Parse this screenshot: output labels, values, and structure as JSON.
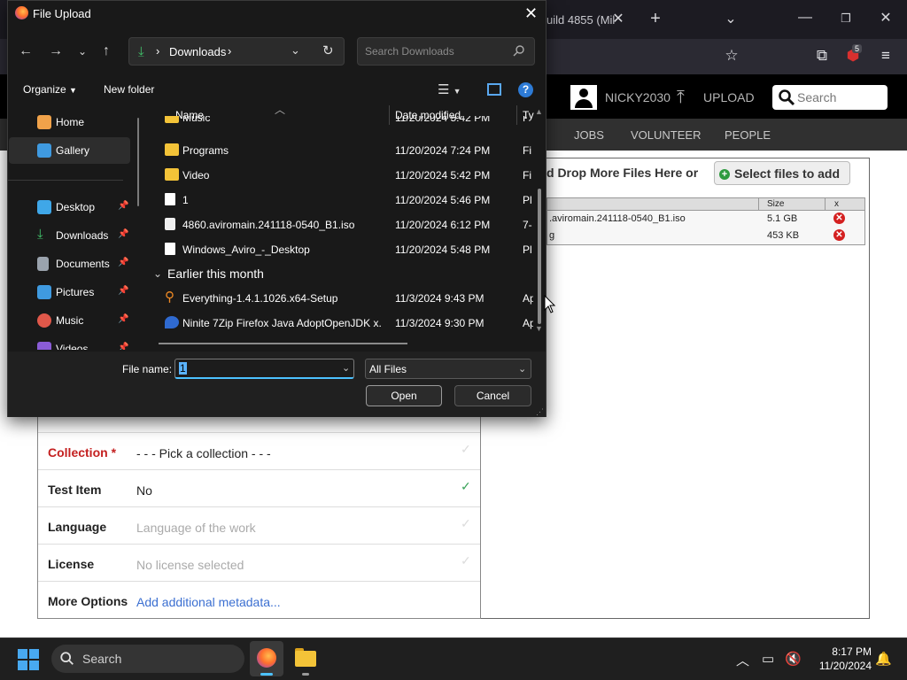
{
  "browser": {
    "tab_title": "uild 4855 (Mil",
    "extension_badge": "5"
  },
  "site": {
    "username": "NICKY2030",
    "upload_label": "UPLOAD",
    "search_label": "Search",
    "nav": [
      "JOBS",
      "VOLUNTEER",
      "PEOPLE"
    ],
    "drop_text": "d Drop More Files Here or",
    "select_files_label": "Select files to add",
    "file_table": {
      "col_size": "Size",
      "col_x": "x",
      "rows": [
        {
          "name": ".aviromain.241118-0540_B1.iso",
          "size": "5.1 GB"
        },
        {
          "name": "g",
          "size": "453 KB"
        }
      ]
    },
    "form": [
      {
        "label": "Collection",
        "required": "*",
        "value": "- - - Pick a collection - - -",
        "value_color": "#222222",
        "check": "✓"
      },
      {
        "label": "Test Item",
        "required": "",
        "value": "No",
        "value_color": "#222222",
        "check": "✓"
      },
      {
        "label": "Language",
        "required": "",
        "value": "Language of the work",
        "value_color": "#aaaaaa",
        "check": "✓"
      },
      {
        "label": "License",
        "required": "",
        "value": "No license selected",
        "value_color": "#aaaaaa",
        "check": "✓"
      },
      {
        "label": "More Options",
        "required": "",
        "value": "Add additional metadata...",
        "value_color": "#3b6fd1",
        "check": ""
      }
    ]
  },
  "dialog": {
    "title": "File Upload",
    "address": "Downloads",
    "search_placeholder": "Search Downloads",
    "organize_label": "Organize",
    "new_folder_label": "New folder",
    "nav_items": [
      {
        "label": "Home",
        "icon": "home-icon",
        "color": "#f0a24a",
        "pinned": ""
      },
      {
        "label": "Gallery",
        "icon": "gallery-icon",
        "color": "#3f9ae0",
        "pinned": ""
      },
      {
        "label": "Desktop",
        "icon": "desktop-icon",
        "color": "#3fa7e8",
        "pinned": "📌"
      },
      {
        "label": "Downloads",
        "icon": "download-icon",
        "color": "#41c26a",
        "pinned": "📌"
      },
      {
        "label": "Documents",
        "icon": "documents-icon",
        "color": "#9aa3ad",
        "pinned": "📌"
      },
      {
        "label": "Pictures",
        "icon": "pictures-icon",
        "color": "#3f9ae0",
        "pinned": "📌"
      },
      {
        "label": "Music",
        "icon": "music-icon",
        "color": "#e0584a",
        "pinned": "📌"
      },
      {
        "label": "Videos",
        "icon": "videos-icon",
        "color": "#8a5cd6",
        "pinned": "📌"
      }
    ],
    "columns": {
      "name": "Name",
      "date": "Date modified",
      "type": "Ty"
    },
    "files": [
      {
        "name": "Music",
        "date": "11/20/2024 5:42 PM",
        "type": "Fi",
        "icon": "folder-icon"
      },
      {
        "name": "Programs",
        "date": "11/20/2024 7:24 PM",
        "type": "Fi",
        "icon": "folder-icon"
      },
      {
        "name": "Video",
        "date": "11/20/2024 5:42 PM",
        "type": "Fi",
        "icon": "folder-icon"
      },
      {
        "name": "1",
        "date": "11/20/2024 5:46 PM",
        "type": "Pl",
        "icon": "doc-icon"
      },
      {
        "name": "4860.aviromain.241118-0540_B1.iso",
        "date": "11/20/2024 6:12 PM",
        "type": "7-",
        "icon": "iso-icon"
      },
      {
        "name": "Windows_Aviro_-_Desktop",
        "date": "11/20/2024 5:48 PM",
        "type": "Pl",
        "icon": "doc-icon"
      }
    ],
    "group_label": "Earlier this month",
    "earlier_files": [
      {
        "name": "Everything-1.4.1.1026.x64-Setup",
        "date": "11/3/2024 9:43 PM",
        "type": "Ap",
        "icon": "setup-icon"
      },
      {
        "name": "Ninite 7Zip Firefox Java AdoptOpenJDK x...",
        "date": "11/3/2024 9:30 PM",
        "type": "Ap",
        "icon": "ninite-icon"
      }
    ],
    "file_name_label": "File name:",
    "file_name_value": "1",
    "file_type_value": "All Files",
    "open_label": "Open",
    "cancel_label": "Cancel"
  },
  "taskbar": {
    "search_label": "Search",
    "time": "8:17 PM",
    "date": "11/20/2024"
  }
}
